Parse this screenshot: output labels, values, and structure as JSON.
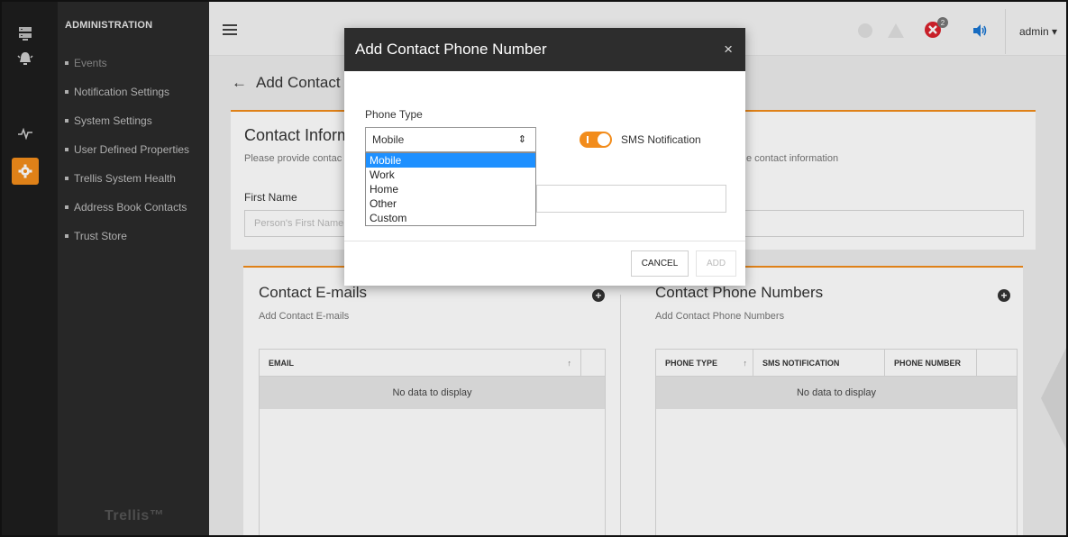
{
  "sidebar": {
    "heading": "ADMINISTRATION",
    "items": [
      {
        "label": "Events"
      },
      {
        "label": "Notification Settings"
      },
      {
        "label": "System Settings"
      },
      {
        "label": "User Defined Properties"
      },
      {
        "label": "Trellis System Health"
      },
      {
        "label": "Address Book Contacts"
      },
      {
        "label": "Trust Store"
      }
    ],
    "brand": "Trellis™"
  },
  "rail": {
    "icons": [
      "server-icon",
      "alarm-bell-icon",
      "pulse-icon",
      "gear-icon"
    ],
    "active_color": "#f28c1b"
  },
  "topbar": {
    "alarm_count": "2",
    "user": "admin"
  },
  "page": {
    "title": "Add Contact",
    "back_icon": "arrow-left-icon",
    "info": {
      "title": "Contact Inform",
      "subtitle": "Please provide contac",
      "subtitle_right": "e contact information",
      "first_name_label": "First Name",
      "first_name_placeholder": "Person's First Name"
    },
    "emails": {
      "title": "Contact E-mails",
      "subtitle": "Add Contact E-mails",
      "columns": [
        "EMAIL"
      ],
      "empty": "No data to display"
    },
    "phones": {
      "title": "Contact Phone Numbers",
      "subtitle": "Add Contact Phone Numbers",
      "columns": [
        "PHONE TYPE",
        "SMS NOTIFICATION",
        "PHONE NUMBER"
      ],
      "empty": "No data to display"
    }
  },
  "modal": {
    "title": "Add Contact Phone Number",
    "close": "×",
    "phone_type_label": "Phone Type",
    "phone_type_value": "Mobile",
    "sms_label": "SMS Notification",
    "sms_enabled": true,
    "cancel_label": "CANCEL",
    "add_label": "ADD"
  },
  "dropdown": {
    "options": [
      "Mobile",
      "Work",
      "Home",
      "Other",
      "Custom"
    ],
    "selected": "Mobile",
    "highlight_color": "#1e90ff"
  }
}
